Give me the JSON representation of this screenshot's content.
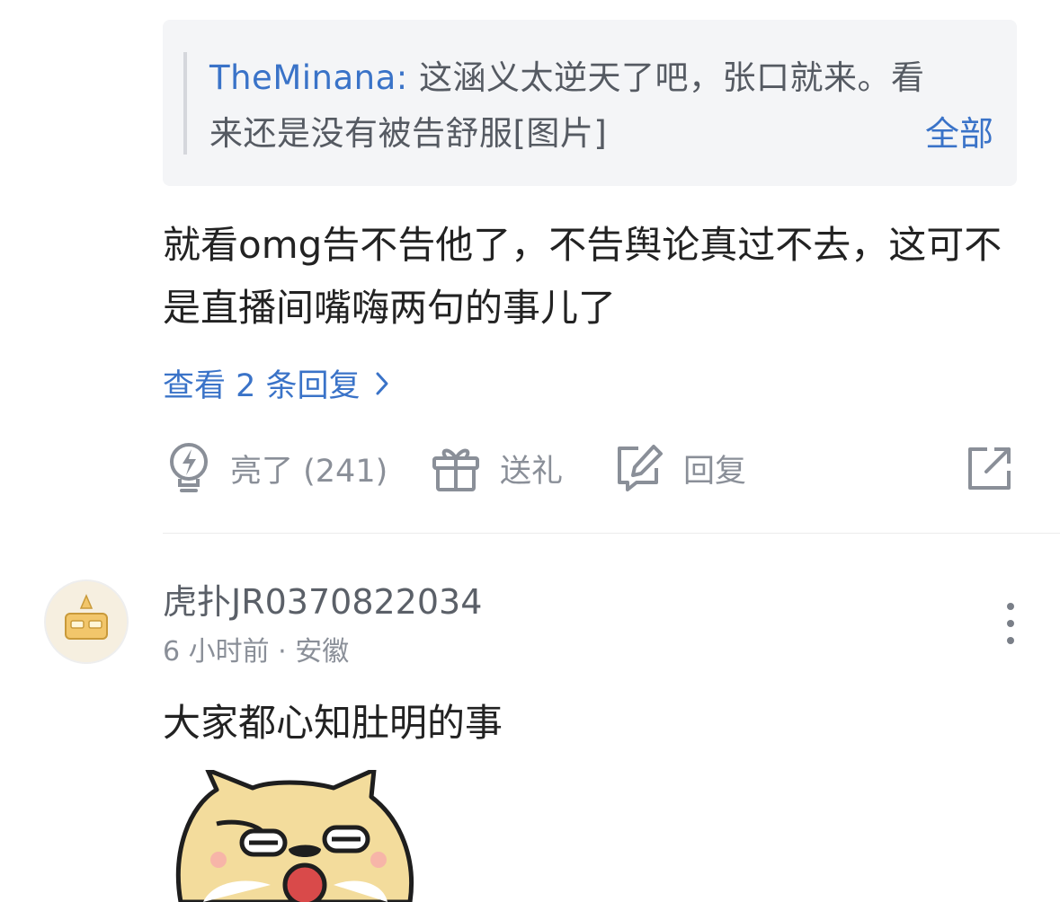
{
  "quoted_reply": {
    "username": "TheMinana:",
    "text": " 这涵义太逆天了吧，张口就来。看来还是没有被告舒服[图片]",
    "expand_label": "全部"
  },
  "comment": {
    "text": "就看omg告不告他了，不告舆论真过不去，这可不是直播间嘴嗨两句的事儿了",
    "view_replies_label": "查看 2 条回复",
    "actions": {
      "like_label": "亮了 (241)",
      "gift_label": "送礼",
      "reply_label": "回复"
    }
  },
  "next_comment": {
    "username": "虎扑JR0370822034",
    "time": "6 小时前",
    "separator": "·",
    "location": "安徽",
    "text": "大家都心知肚明的事"
  },
  "icons": {
    "like": "lightbulb-icon",
    "gift": "gift-icon",
    "reply": "edit-icon",
    "share": "share-icon",
    "more": "more-vertical-icon",
    "chevron": "chevron-right-icon"
  },
  "colors": {
    "link": "#3a73c8",
    "body_text": "#222222",
    "secondary_text": "#8a8f98",
    "quote_bg": "#f4f5f7"
  }
}
